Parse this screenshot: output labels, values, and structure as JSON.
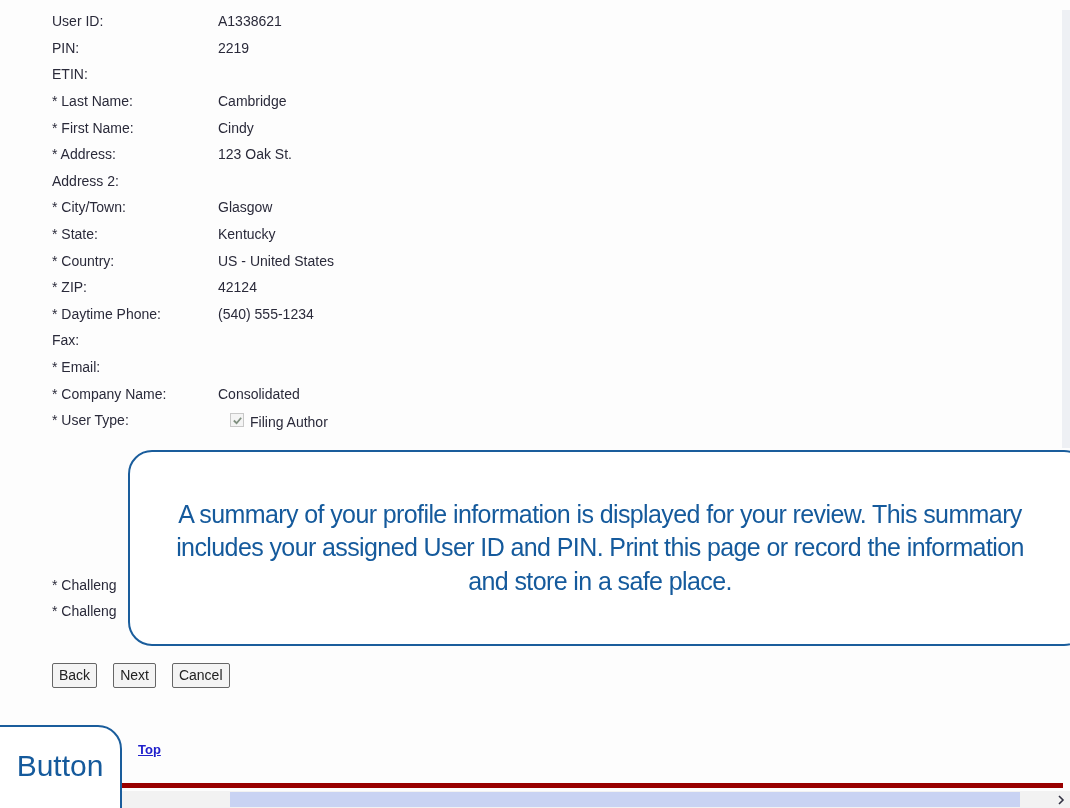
{
  "profile_fields": [
    {
      "kind": "text",
      "label": "User ID:",
      "value": "A1338621"
    },
    {
      "kind": "text",
      "label": "PIN:",
      "value": "2219"
    },
    {
      "kind": "text",
      "label": "ETIN:"
    },
    {
      "kind": "text",
      "label": "* Last Name:",
      "value": "Cambridge"
    },
    {
      "kind": "text",
      "label": "* First Name:",
      "value": "Cindy"
    },
    {
      "kind": "text",
      "label": "* Address:",
      "value": "123 Oak St."
    },
    {
      "kind": "text",
      "label": "Address 2:"
    },
    {
      "kind": "text",
      "label": "* City/Town:",
      "value": "Glasgow"
    },
    {
      "kind": "text",
      "label": "* State:",
      "value": "Kentucky"
    },
    {
      "kind": "text",
      "label": "* Country:",
      "value": "US - United States"
    },
    {
      "kind": "text",
      "label": "* ZIP:",
      "value": "42124"
    },
    {
      "kind": "text",
      "label": "* Daytime Phone:",
      "value": "(540) 555-1234"
    },
    {
      "kind": "text",
      "label": "Fax:"
    },
    {
      "kind": "text",
      "label": "* Email:"
    },
    {
      "kind": "text",
      "label": "* Company Name:",
      "value": "Consolidated"
    },
    {
      "kind": "checkbox",
      "label": "* User Type:",
      "value": "Filing Author",
      "checked": true,
      "disabled": true
    }
  ],
  "challenge_fields": [
    {
      "label": "* Challeng"
    },
    {
      "label": "* Challeng"
    }
  ],
  "buttons": [
    "Back",
    "Next",
    "Cancel"
  ],
  "top_link": "Top",
  "callout": "A summary of your profile information is displayed for your review. This summary includes your assigned User ID and PIN. Print this page or record the information and store in a safe place.",
  "button_callout": "Button"
}
